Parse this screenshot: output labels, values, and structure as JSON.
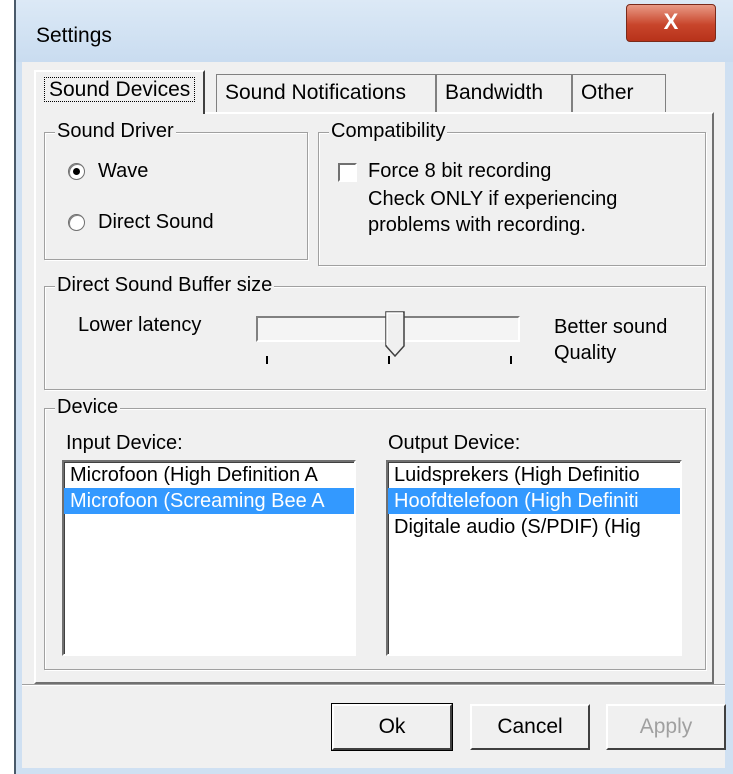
{
  "window": {
    "title": "Settings",
    "close_label": "X"
  },
  "tabs": [
    {
      "label": "Sound Devices"
    },
    {
      "label": "Sound Notifications"
    },
    {
      "label": "Bandwidth"
    },
    {
      "label": "Other"
    }
  ],
  "sound_driver": {
    "legend": "Sound Driver",
    "options": [
      {
        "label": "Wave",
        "selected": true
      },
      {
        "label": "Direct Sound",
        "selected": false
      }
    ]
  },
  "compatibility": {
    "legend": "Compatibility",
    "checkbox_label": "Force 8 bit recording",
    "checked": false,
    "note_line1": "Check ONLY if experiencing",
    "note_line2": "problems with recording."
  },
  "buffer": {
    "legend": "Direct Sound Buffer size",
    "left_label": "Lower latency",
    "right_label_line1": "Better sound",
    "right_label_line2": "Quality",
    "value_fraction": 0.5
  },
  "device": {
    "legend": "Device",
    "input_label": "Input Device:",
    "output_label": "Output Device:",
    "input_items": [
      {
        "label": "Microfoon (High Definition A",
        "selected": false
      },
      {
        "label": "Microfoon (Screaming Bee A",
        "selected": true
      }
    ],
    "output_items": [
      {
        "label": "Luidsprekers (High Definitio",
        "selected": false
      },
      {
        "label": "Hoofdtelefoon (High Definiti",
        "selected": true
      },
      {
        "label": "Digitale audio (S/PDIF) (Hig",
        "selected": false
      }
    ]
  },
  "buttons": {
    "ok": "Ok",
    "cancel": "Cancel",
    "apply": "Apply"
  },
  "colors": {
    "selection": "#3399ff",
    "close_button": "#c8452b"
  }
}
